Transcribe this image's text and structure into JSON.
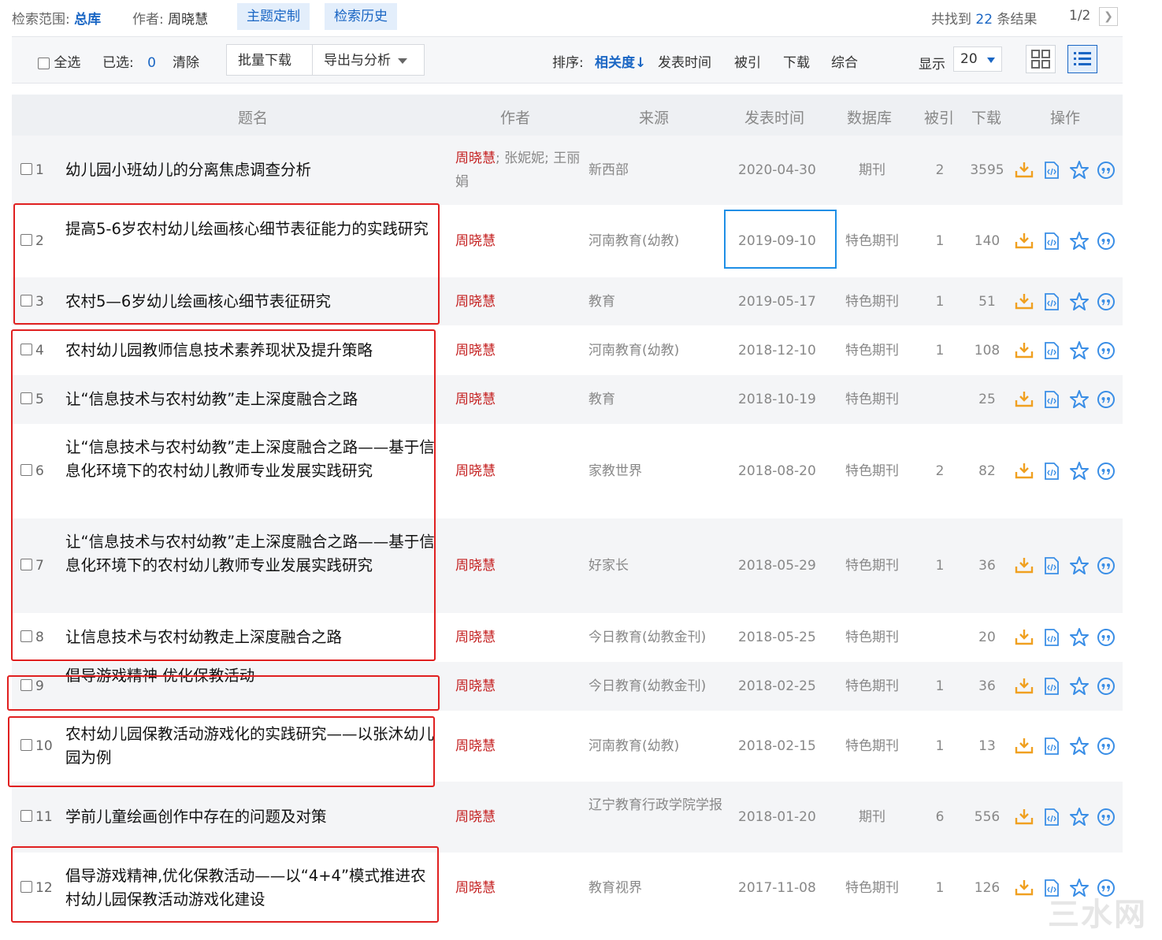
{
  "topbar": {
    "scope_label": "检索范围:",
    "scope_value": "总库",
    "author_label": "作者:",
    "author_value": "周晓慧",
    "tab_topic": "主题定制",
    "tab_history": "检索历史",
    "found_prefix": "共找到",
    "found_count": "22",
    "found_suffix": "条结果",
    "page": "1/2"
  },
  "toolbar": {
    "select_all": "全选",
    "selected_label": "已选:",
    "selected_count": "0",
    "clear": "清除",
    "batch_download": "批量下载",
    "export_analyze": "导出与分析",
    "sort_label": "排序:",
    "sort_relevance": "相关度",
    "sort_date": "发表时间",
    "sort_cited": "被引",
    "sort_download": "下载",
    "sort_overall": "综合",
    "show_label": "显示",
    "show_value": "20"
  },
  "headers": {
    "title": "题名",
    "author": "作者",
    "source": "来源",
    "date": "发表时间",
    "db": "数据库",
    "cite": "被引",
    "download": "下载",
    "ops": "操作"
  },
  "rows": [
    {
      "num": "1",
      "title": "幼儿园小班幼儿的分离焦虑调查分析",
      "author_main": "周晓慧",
      "author_rest": "; 张妮妮; 王丽娟",
      "source": "新西部",
      "date": "2020-04-30",
      "db": "期刊",
      "cite": "2",
      "download": "3595"
    },
    {
      "num": "2",
      "title": "提高5-6岁农村幼儿绘画核心细节表征能力的实践研究",
      "author_main": "周晓慧",
      "author_rest": "",
      "source": "河南教育(幼教)",
      "date": "2019-09-10",
      "db": "特色期刊",
      "cite": "1",
      "download": "140"
    },
    {
      "num": "3",
      "title": "农村5—6岁幼儿绘画核心细节表征研究",
      "author_main": "周晓慧",
      "author_rest": "",
      "source": "教育",
      "date": "2019-05-17",
      "db": "特色期刊",
      "cite": "1",
      "download": "51"
    },
    {
      "num": "4",
      "title": "农村幼儿园教师信息技术素养现状及提升策略",
      "author_main": "周晓慧",
      "author_rest": "",
      "source": "河南教育(幼教)",
      "date": "2018-12-10",
      "db": "特色期刊",
      "cite": "1",
      "download": "108"
    },
    {
      "num": "5",
      "title": "让“信息技术与农村幼教”走上深度融合之路",
      "author_main": "周晓慧",
      "author_rest": "",
      "source": "教育",
      "date": "2018-10-19",
      "db": "特色期刊",
      "cite": "",
      "download": "25"
    },
    {
      "num": "6",
      "title": "让“信息技术与农村幼教”走上深度融合之路——基于信息化环境下的农村幼儿教师专业发展实践研究",
      "author_main": "周晓慧",
      "author_rest": "",
      "source": "家教世界",
      "date": "2018-08-20",
      "db": "特色期刊",
      "cite": "2",
      "download": "82"
    },
    {
      "num": "7",
      "title": "让“信息技术与农村幼教”走上深度融合之路——基于信息化环境下的农村幼儿教师专业发展实践研究",
      "author_main": "周晓慧",
      "author_rest": "",
      "source": "好家长",
      "date": "2018-05-29",
      "db": "特色期刊",
      "cite": "1",
      "download": "36"
    },
    {
      "num": "8",
      "title": "让信息技术与农村幼教走上深度融合之路",
      "author_main": "周晓慧",
      "author_rest": "",
      "source": "今日教育(幼教金刊)",
      "date": "2018-05-25",
      "db": "特色期刊",
      "cite": "",
      "download": "20"
    },
    {
      "num": "9",
      "title": "倡导游戏精神 优化保教活动",
      "author_main": "周晓慧",
      "author_rest": "",
      "source": "今日教育(幼教金刊)",
      "date": "2018-02-25",
      "db": "特色期刊",
      "cite": "1",
      "download": "36"
    },
    {
      "num": "10",
      "title": "农村幼儿园保教活动游戏化的实践研究——以张沐幼儿园为例",
      "author_main": "周晓慧",
      "author_rest": "",
      "source": "河南教育(幼教)",
      "date": "2018-02-15",
      "db": "特色期刊",
      "cite": "1",
      "download": "13"
    },
    {
      "num": "11",
      "title": "学前儿童绘画创作中存在的问题及对策",
      "author_main": "周晓慧",
      "author_rest": "",
      "source": "辽宁教育行政学院学报",
      "date": "2018-01-20",
      "db": "期刊",
      "cite": "6",
      "download": "556"
    },
    {
      "num": "12",
      "title": "倡导游戏精神,优化保教活动——以“4+4”模式推进农村幼儿园保教活动游戏化建设",
      "author_main": "周晓慧",
      "author_rest": "",
      "source": "教育视界",
      "date": "2017-11-08",
      "db": "特色期刊",
      "cite": "1",
      "download": "126"
    }
  ],
  "watermark": "三水网",
  "colors": {
    "accent": "#1a66c4",
    "author_highlight": "#c41f1f",
    "annotation_red": "#e02020",
    "annotation_blue": "#1e8fe6",
    "download_icon": "#f0a020"
  }
}
